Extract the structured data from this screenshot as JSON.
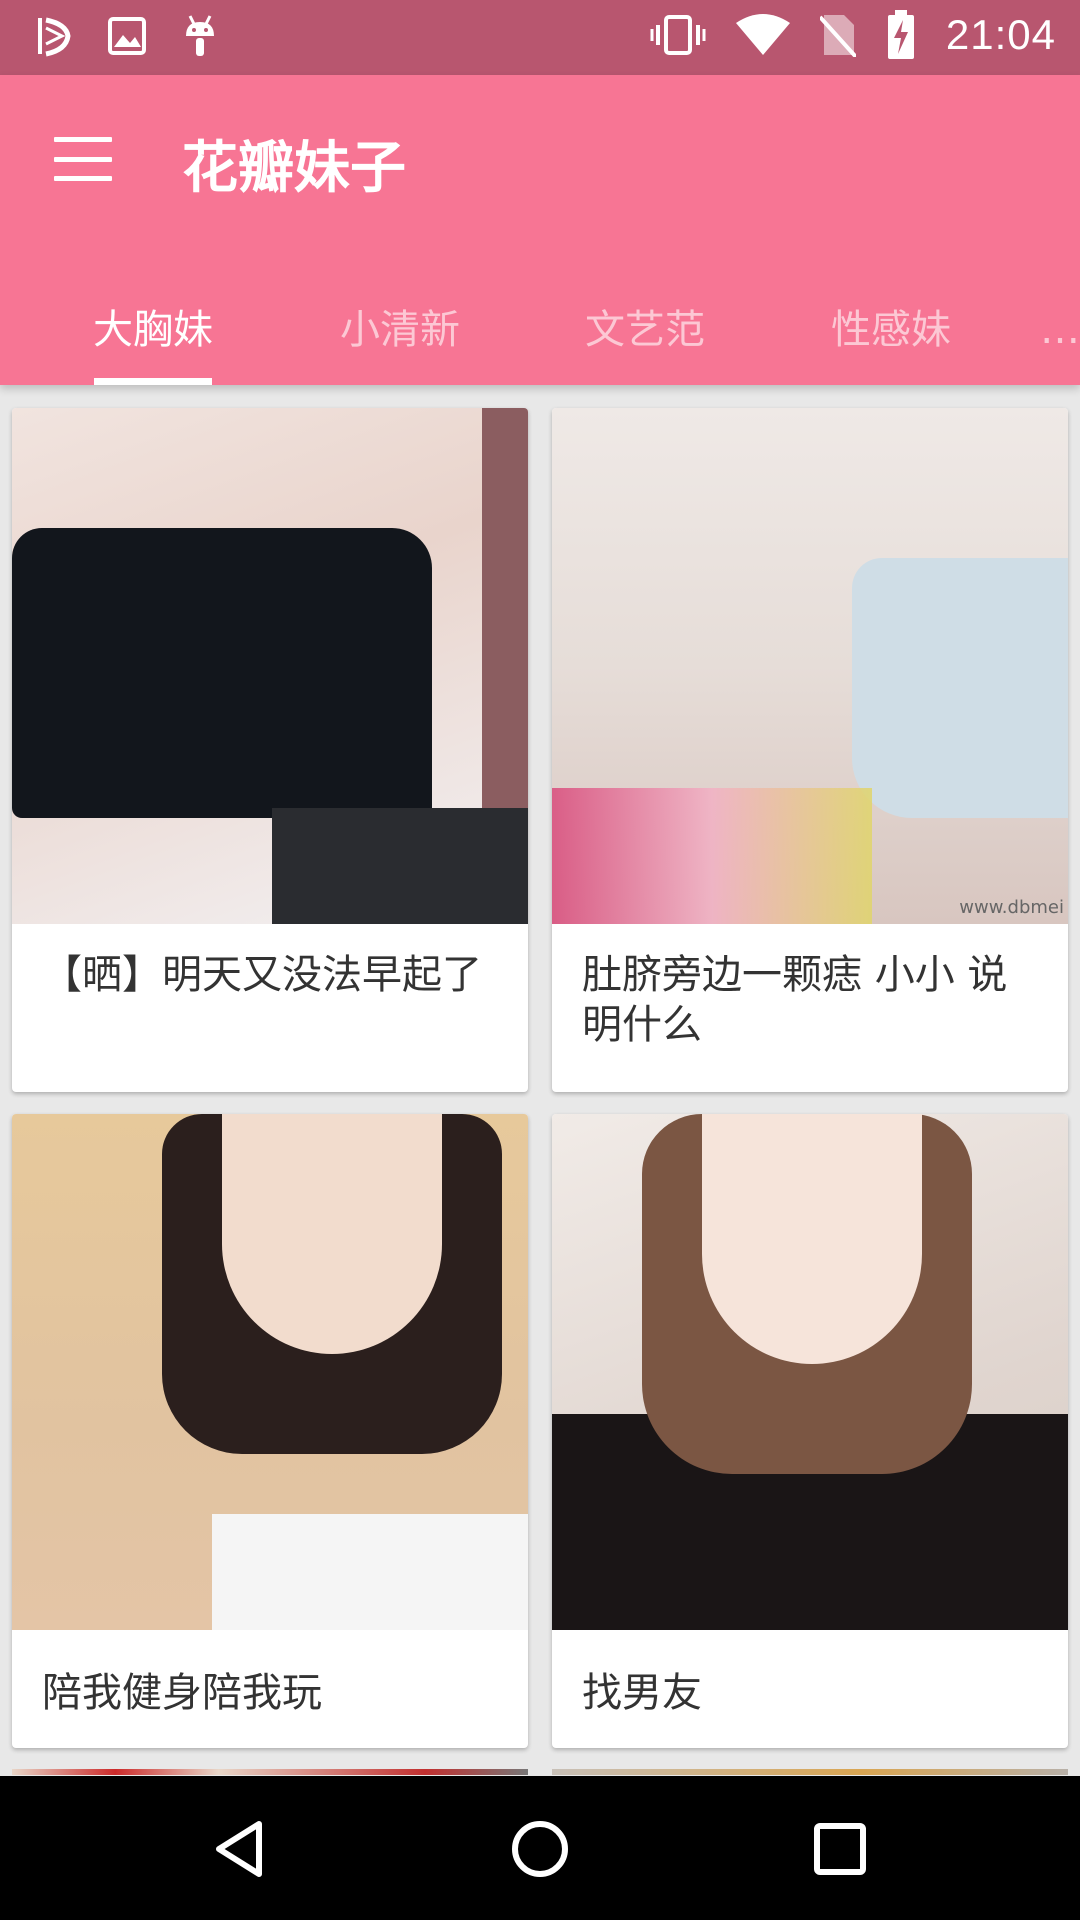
{
  "status_bar": {
    "time": "21:04",
    "icons": [
      "app-logo-icon",
      "image-notification-icon",
      "android-debug-icon",
      "vibrate-icon",
      "wifi-icon",
      "no-sim-icon",
      "battery-charging-icon"
    ]
  },
  "app_bar": {
    "title": "花瓣妹子",
    "menu_icon": "hamburger-menu-icon"
  },
  "tabs": [
    {
      "label": "大胸妹",
      "active": true
    },
    {
      "label": "小清新",
      "active": false
    },
    {
      "label": "文艺范",
      "active": false
    },
    {
      "label": "性感妹",
      "active": false
    }
  ],
  "cards": [
    {
      "caption": "【晒】明天又没法早起了"
    },
    {
      "caption": "肚脐旁边一颗痣 小小 说明什么",
      "watermark": "www.dbmei"
    },
    {
      "caption": "陪我健身陪我玩"
    },
    {
      "caption": "找男友"
    }
  ],
  "nav_bar": {
    "icons": [
      "back-icon",
      "home-icon",
      "recents-icon"
    ]
  },
  "colors": {
    "status_bar": "#b8566f",
    "app_bar": "#f77594",
    "background": "#e8e8e8"
  }
}
